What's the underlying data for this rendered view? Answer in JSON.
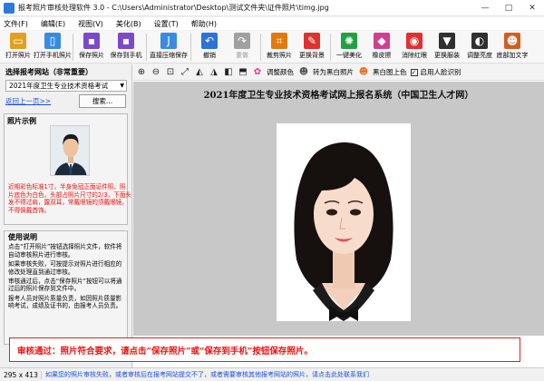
{
  "window": {
    "title": "报考照片审核处理软件 3.0 - C:\\Users\\Administrator\\Desktop\\测试文件夹\\证件照片\\timg.jpg"
  },
  "menu": [
    "文件(F)",
    "编辑(E)",
    "视图(V)",
    "美化(B)",
    "设置(T)",
    "帮助(H)"
  ],
  "toolbar": [
    {
      "label": "打开照片",
      "icon": "folder-open-icon",
      "color": "#e0a020",
      "glyph": "▭"
    },
    {
      "label": "打开手机照片",
      "icon": "phone-icon",
      "color": "#3a8be0",
      "glyph": "▯"
    },
    {
      "label": "保存照片",
      "icon": "save-icon",
      "color": "#7a4ac8",
      "glyph": "▪"
    },
    {
      "label": "保存到手机",
      "icon": "save-to-phone-icon",
      "color": "#7a4ac8",
      "glyph": "▪"
    },
    {
      "label": "直接压缩保存",
      "icon": "jpg-compress-icon",
      "color": "#3a8be0",
      "glyph": "J"
    },
    {
      "label": "撤销",
      "icon": "undo-icon",
      "color": "#2b74d6",
      "glyph": "↶"
    },
    {
      "label": "重做",
      "icon": "redo-icon",
      "color": "#a0a0a0",
      "glyph": "↷",
      "disabled": true
    },
    {
      "label": "裁剪照片",
      "icon": "crop-icon",
      "color": "#e07a10",
      "glyph": "⌗"
    },
    {
      "label": "更换背景",
      "icon": "background-icon",
      "color": "#e03030",
      "glyph": "✎"
    },
    {
      "label": "一键美化",
      "icon": "beautify-icon",
      "color": "#20a040",
      "glyph": "✺"
    },
    {
      "label": "橡皮擦",
      "icon": "eraser-icon",
      "color": "#d04090",
      "glyph": "◆"
    },
    {
      "label": "消除红眼",
      "icon": "red-eye-icon",
      "color": "#e03030",
      "glyph": "◉"
    },
    {
      "label": "更换服装",
      "icon": "clothes-icon",
      "color": "#303030",
      "glyph": "▼"
    },
    {
      "label": "调整亮度",
      "icon": "brightness-icon",
      "color": "#303030",
      "glyph": "◐"
    },
    {
      "label": "底部加文字",
      "icon": "add-text-icon",
      "color": "#d06020",
      "glyph": "☻"
    }
  ],
  "left": {
    "exam_header": "选择报考网站（非常重要）",
    "exam_value": "2021年度卫生专业技术资格考试",
    "return_link": "返回上一页>>",
    "search_button": "搜索...",
    "sample_header": "照片示例",
    "sample_rule": "近期彩色标准1寸，半身免冠正面证件照，照片底色为白色，头部占照片尺寸的2/3，下面头发不得过肩，露双耳，常戴眼镜的须戴眼镜，不得佩戴首饰。",
    "usage_header": "使用说明",
    "usage": [
      "点击“打开照片”按钮选择照片文件，软件将自动审核照片进行审核。",
      "如果审核失败，可按提示对照片进行相应的修改处理直到通过审核。",
      "审核通过后，点击“保存照片”按钮可以将通过后的照片保存到文件中。",
      "报考人员对照片质量负责，如因照片质量影响考试，成绩及证书的，由报考人员负责。"
    ]
  },
  "image_toolbar": {
    "adjust_color": "调整颜色",
    "gray": "转为黑白照片",
    "bw_up": "黑白图上色",
    "face_detect": "启用人脸识别",
    "face_detect_checked": true
  },
  "canvas": {
    "heading": "2021年度卫生专业技术资格考试网上报名系统（中国卫生人才网）"
  },
  "result": {
    "message": "审核通过：照片符合要求，请点击“保存照片”或“保存到手机”按钮保存照片。"
  },
  "status": {
    "dimensions": "295 x 413",
    "message": "如果您的照片审核失败，或者审核后在报考网站提交不了，或者需要审核其他报考网站的照片，请点击此处联系我们"
  },
  "colors": {
    "accent_red": "#e02020",
    "link_blue": "#1a4fd8"
  }
}
